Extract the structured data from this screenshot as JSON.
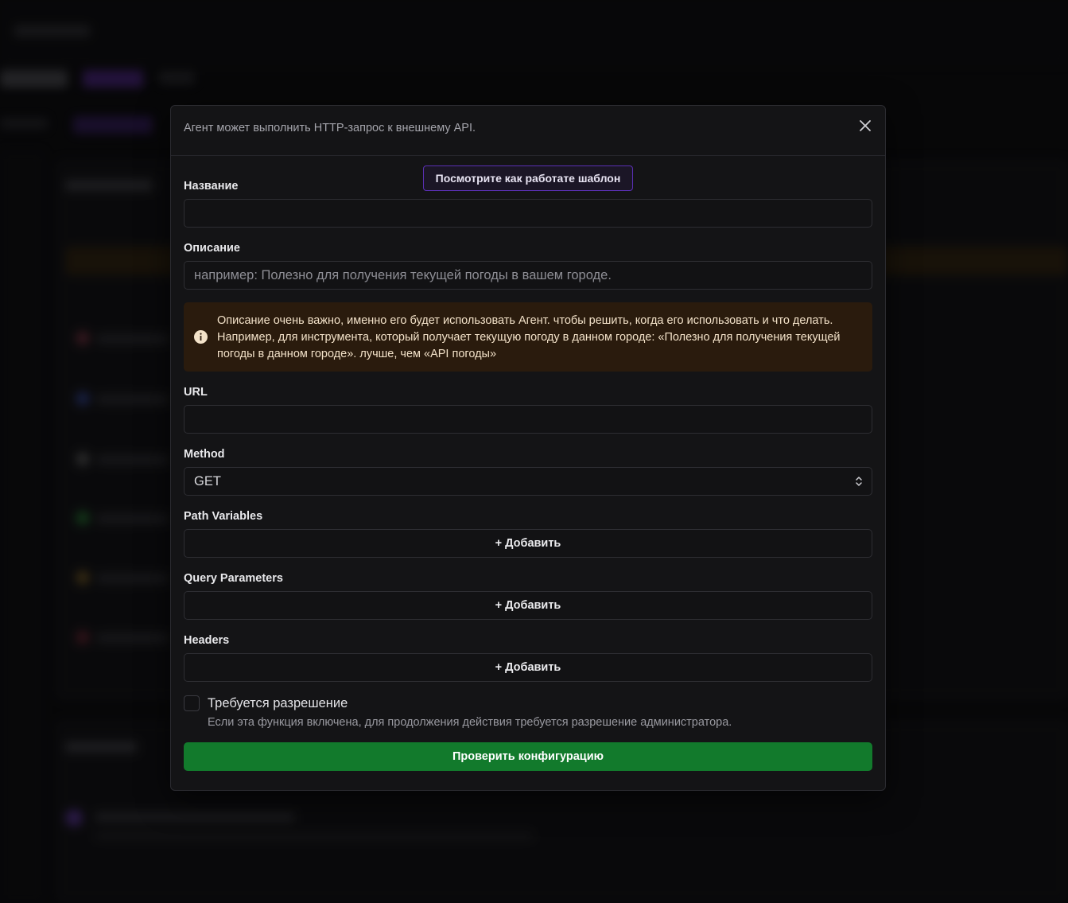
{
  "modal": {
    "description": "Агент может выполнить HTTP-запрос к внешнему API.",
    "template_button": "Посмотрите как работате шаблон",
    "name": {
      "label": "Название",
      "value": "",
      "placeholder": ""
    },
    "description_field": {
      "label": "Описание",
      "value": "",
      "placeholder": "например: Полезно для получения текущей погоды в вашем городе."
    },
    "alert": {
      "text": "Описание очень важно, именно его будет использовать Агент. чтобы решить, когда его использовать и что делать. Например, для инструмента, который получает текущую погоду в данном городе: «Полезно для получения текущей погоды в данном городе». лучше, чем «API погоды»",
      "icon": "info-icon",
      "color": "#2a1b0d"
    },
    "url": {
      "label": "URL",
      "value": ""
    },
    "method": {
      "label": "Method",
      "value": "GET"
    },
    "path_variables": {
      "label": "Path Variables",
      "add_label": "+ Добавить"
    },
    "query_parameters": {
      "label": "Query Parameters",
      "add_label": "+ Добавить"
    },
    "headers": {
      "label": "Headers",
      "add_label": "+ Добавить"
    },
    "permission": {
      "label": "Требуется разрешение",
      "help": "Если эта функция включена, для продолжения действия требуется разрешение администратора.",
      "checked": false
    },
    "verify_button": "Проверить конфигурацию",
    "accent_color": "#127a2c",
    "template_accent": "#5a2fb3"
  }
}
